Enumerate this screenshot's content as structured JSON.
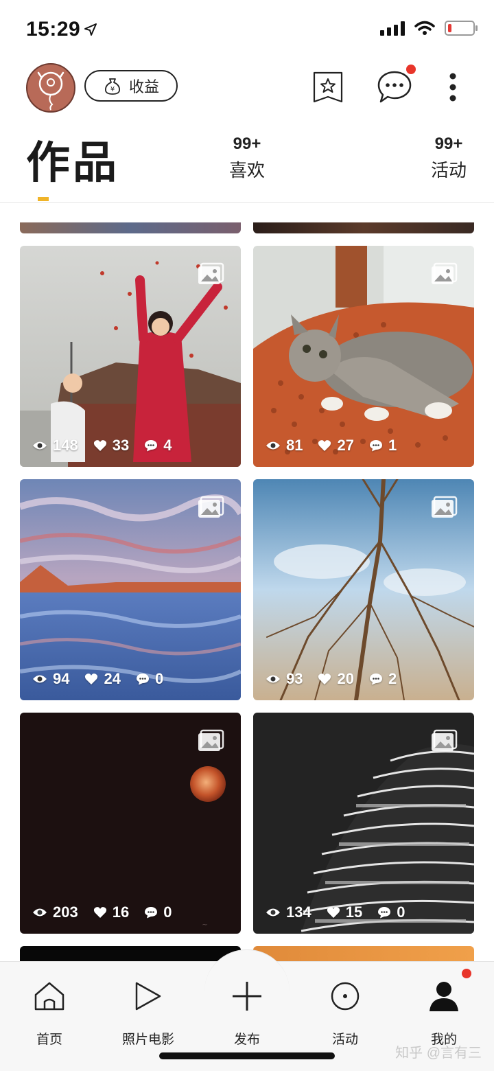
{
  "status_bar": {
    "time": "15:29"
  },
  "header": {
    "earnings_label": "收益"
  },
  "tabs": {
    "main_label": "作品",
    "likes": {
      "count": "99+",
      "label": "喜欢"
    },
    "activities": {
      "count": "99+",
      "label": "活动"
    }
  },
  "posts": [
    {
      "views": "148",
      "likes": "33",
      "comments": "4"
    },
    {
      "views": "81",
      "likes": "27",
      "comments": "1"
    },
    {
      "views": "94",
      "likes": "24",
      "comments": "0"
    },
    {
      "views": "93",
      "likes": "20",
      "comments": "2"
    },
    {
      "views": "203",
      "likes": "16",
      "comments": "0"
    },
    {
      "views": "134",
      "likes": "15",
      "comments": "0"
    }
  ],
  "bottom_nav": {
    "home": "首页",
    "photo_movie": "照片电影",
    "publish": "发布",
    "activity": "活动",
    "me": "我的"
  },
  "watermark": "知乎 @言有三",
  "colors": {
    "accent": "#f0b429",
    "badge": "#e8352a"
  }
}
